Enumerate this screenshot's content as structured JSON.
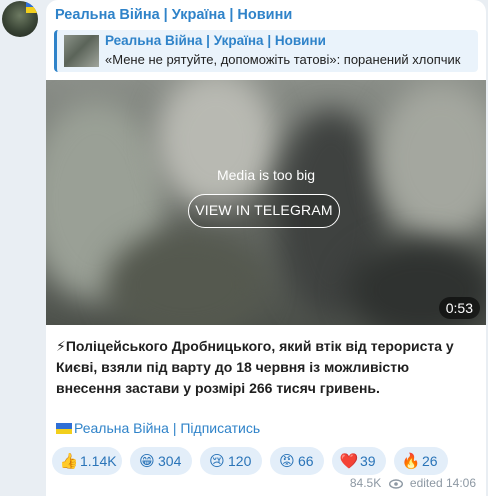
{
  "channel": {
    "name": "Реальна Війна | Україна | Новини"
  },
  "reply": {
    "title": "Реальна Війна | Україна | Новини",
    "text": "«Мене не рятуйте, допоможіть татові»: поранений хлопчик"
  },
  "media": {
    "message": "Media is too big",
    "button_label": "VIEW IN TELEGRAM",
    "duration": "0:53"
  },
  "post": {
    "emoji": "⚡",
    "text": "Поліцейського Дробницького, який втік від терориста у Києві, взяли під варту до 18 червня із можливістю внесення застави у розмірі 266 тисяч гривень.",
    "subscribe_link": "Реальна Війна | Підписатись"
  },
  "reactions": [
    {
      "emoji": "👍",
      "count": "1.14K"
    },
    {
      "emoji": "😁",
      "count": "304"
    },
    {
      "emoji": "😢",
      "count": "120"
    },
    {
      "emoji": "😡",
      "count": "66"
    },
    {
      "emoji": "❤️",
      "count": "39"
    },
    {
      "emoji": "🔥",
      "count": "26"
    }
  ],
  "footer": {
    "views": "84.5K",
    "edited_label": "edited",
    "time": "14:06"
  }
}
